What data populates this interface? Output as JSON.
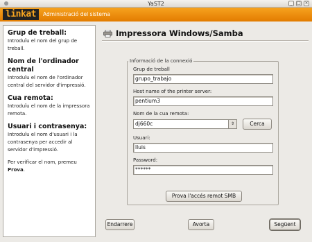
{
  "window": {
    "title": "YaST2"
  },
  "banner": {
    "logo": "linkat",
    "title": "Administració del sistema"
  },
  "help": [
    {
      "heading": "Grup de treball:",
      "text": "Introduïu el nom del grup de treball."
    },
    {
      "heading": "Nom de l'ordinador central",
      "text": "Introduïu el nom de l'ordinador central del servidor d'impressió."
    },
    {
      "heading": "Cua remota:",
      "text": "Introduïu el nom de la impressora remota."
    },
    {
      "heading": "Usuari i contrasenya:",
      "text": "Introduïu el nom d'usuari i la contrasenya per accedir al servidor d'impressió."
    }
  ],
  "help_footer": {
    "text": "Per verificar el nom, premeu",
    "bold": "Prova",
    "end": "."
  },
  "main": {
    "title": "Impressora Windows/Samba",
    "group_label": "Informació de la connexió",
    "workgroup": {
      "label": "Grup de treball",
      "value": "grupo_trabajo"
    },
    "host": {
      "label": "Host name of the printer server:",
      "value": "pentium3"
    },
    "queue": {
      "label": "Nom de la cua remota:",
      "value": "dj660c",
      "search_label": "Cerca"
    },
    "user": {
      "label": "Usuari:",
      "value": "lluis"
    },
    "password": {
      "label": "Password:",
      "value": "******"
    },
    "test_button": "Prova l'accés remot SMB"
  },
  "footer": {
    "back": "Endarrere",
    "abort": "Avorta",
    "next": "Següent"
  },
  "colors": {
    "banner": "#f08c00",
    "logo_bg": "#222222",
    "logo_text": "#f7a520"
  }
}
